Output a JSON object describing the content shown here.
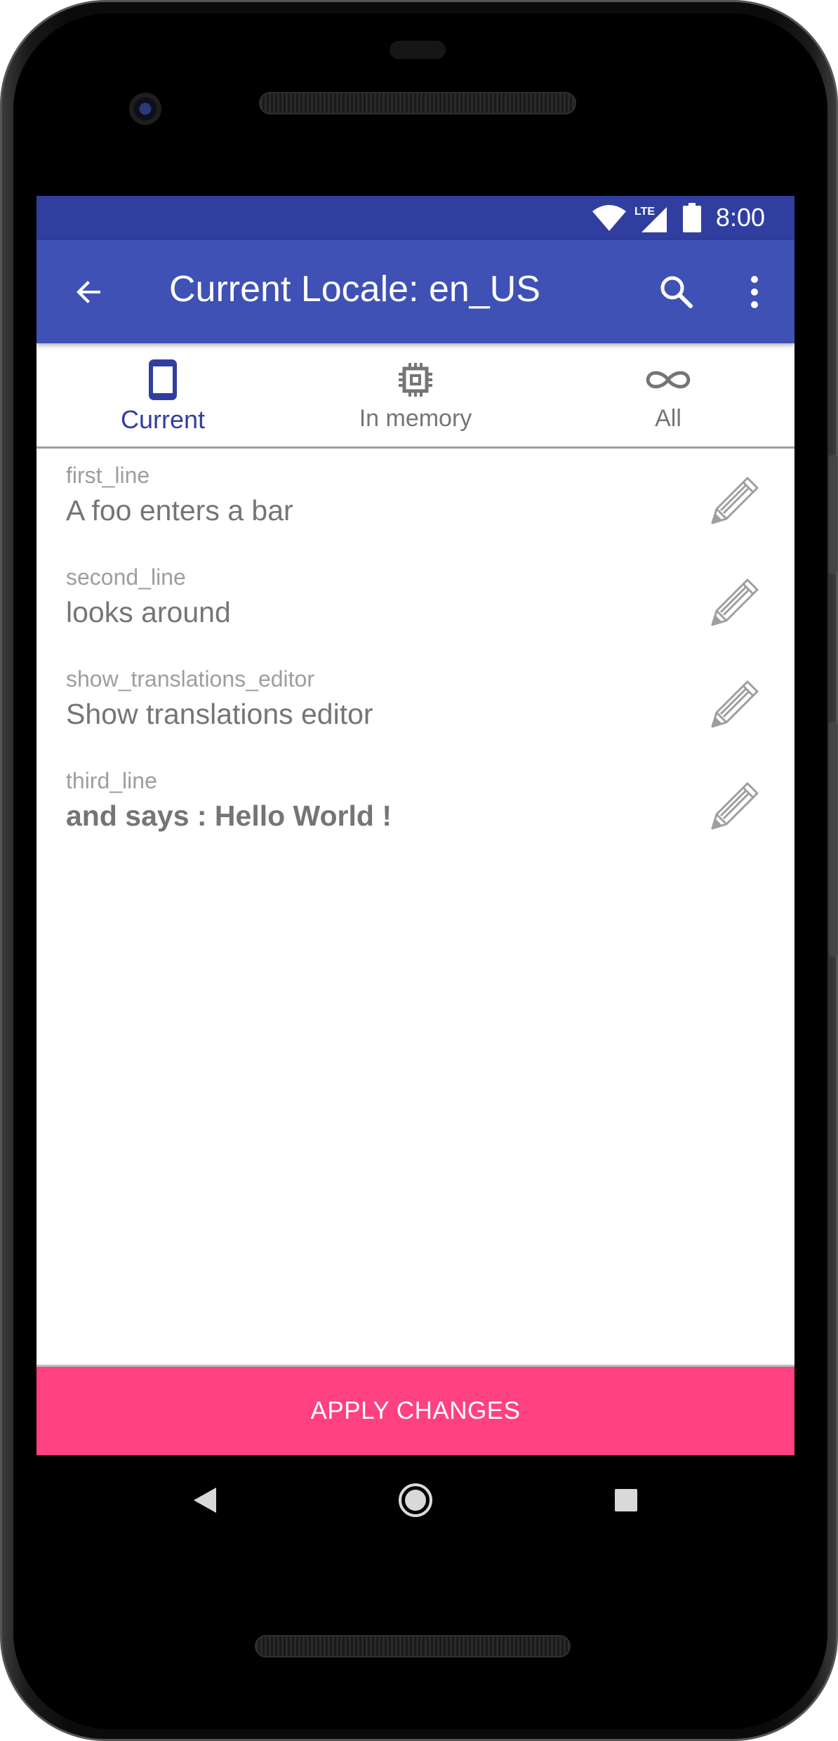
{
  "status_bar": {
    "time": "8:00",
    "network_label": "LTE",
    "icons": [
      "wifi-icon",
      "signal-icon",
      "battery-icon"
    ]
  },
  "toolbar": {
    "title": "Current Locale: en_US",
    "back_icon": "arrow-back-icon",
    "search_icon": "search-icon",
    "more_icon": "more-vert-icon"
  },
  "tabs": [
    {
      "label": "Current",
      "icon": "phone-icon",
      "active": true
    },
    {
      "label": "In memory",
      "icon": "chip-icon",
      "active": false
    },
    {
      "label": "All",
      "icon": "infinity-icon",
      "active": false
    }
  ],
  "strings": [
    {
      "key": "first_line",
      "value": "A foo enters a bar",
      "bold": false
    },
    {
      "key": "second_line",
      "value": "looks around",
      "bold": false
    },
    {
      "key": "show_translations_editor",
      "value": "Show translations editor",
      "bold": false
    },
    {
      "key": "third_line",
      "value": "and says : Hello World !",
      "bold": true
    }
  ],
  "apply_button": {
    "label": "APPLY CHANGES"
  },
  "colors": {
    "status_bar": "#303f9f",
    "toolbar": "#3f51b5",
    "accent": "#ff4081",
    "active_tab": "#303f9f"
  }
}
